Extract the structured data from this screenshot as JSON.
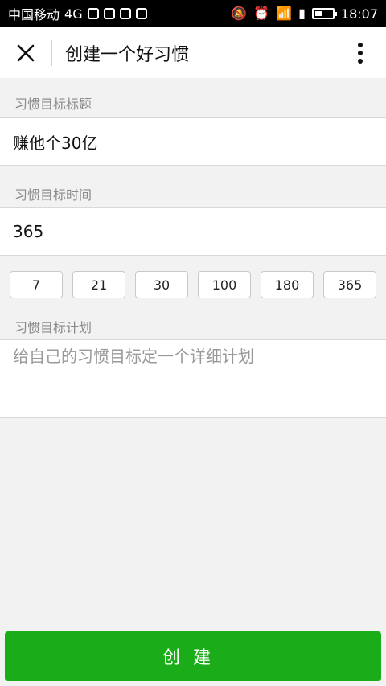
{
  "status_bar": {
    "carrier": "中国移动",
    "network": "4G",
    "time": "18:07"
  },
  "header": {
    "title": "创建一个好习惯"
  },
  "form": {
    "title_label": "习惯目标标题",
    "title_value": "赚他个30亿",
    "duration_label": "习惯目标时间",
    "duration_value": "365",
    "duration_options": [
      "7",
      "21",
      "30",
      "100",
      "180",
      "365"
    ],
    "plan_label": "习惯目标计划",
    "plan_placeholder": "给自己的习惯目标定一个详细计划"
  },
  "actions": {
    "create_label": "创建"
  },
  "colors": {
    "accent": "#1aad19"
  }
}
